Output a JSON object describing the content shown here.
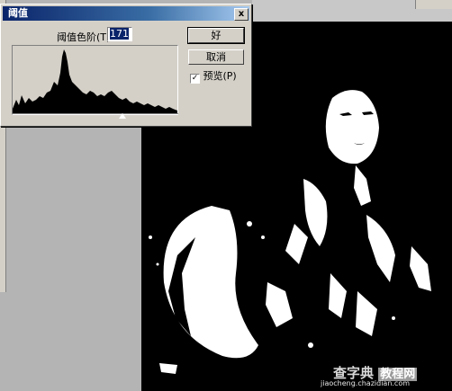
{
  "dialog": {
    "title": "阈值",
    "close_label": "x",
    "threshold_label": "阈值色阶(T):",
    "threshold_value": "171",
    "ok_label": "好",
    "cancel_label": "取消",
    "preview_label": "预览(P)",
    "preview_checked": true,
    "preview_check_glyph": "✓",
    "histogram_slider_level": 171
  },
  "watermark": {
    "site_name": "查字典",
    "tag": "教程网",
    "url": "jiaocheng.chazidian.com"
  },
  "colors": {
    "dialog_bg": "#d4d0c8",
    "title_bar": "#0a246a",
    "canvas_bg": "#000000",
    "workspace": "#b4b4b4"
  }
}
